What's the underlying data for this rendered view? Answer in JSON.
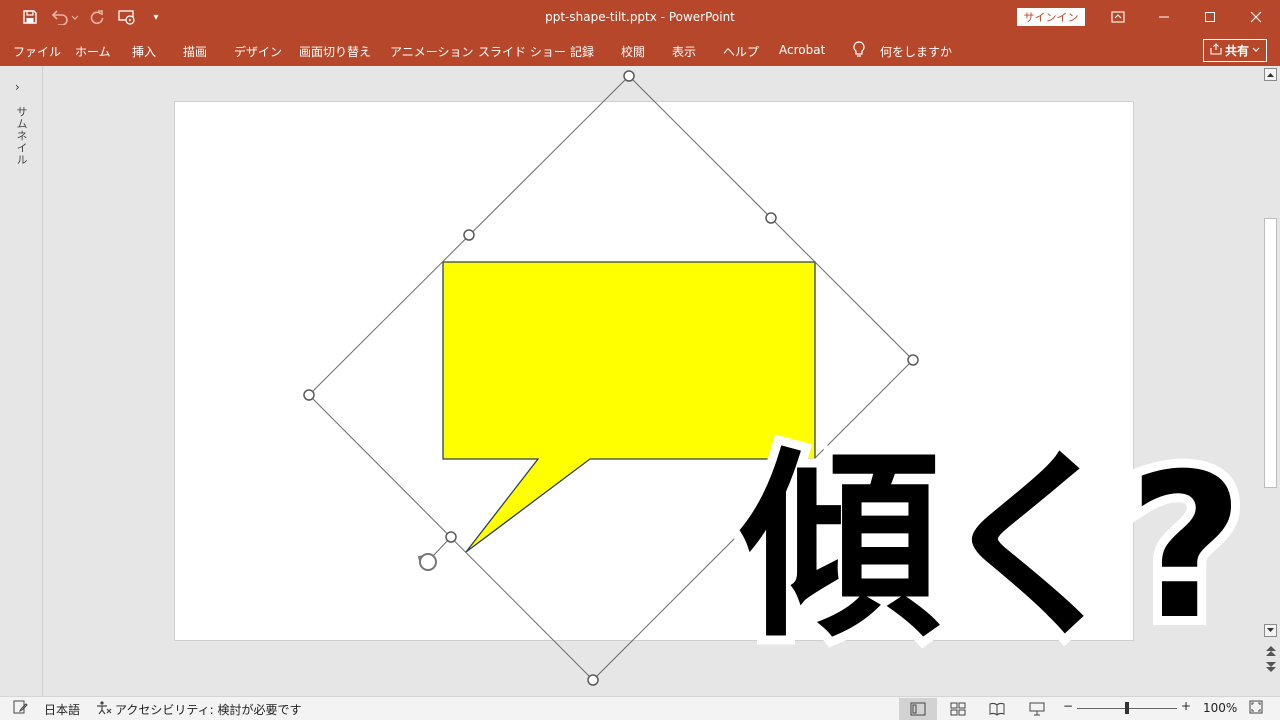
{
  "titlebar": {
    "doc_title": "ppt-shape-tilt.pptx  -  PowerPoint",
    "signin_label": "サインイン",
    "qat_more": "▾"
  },
  "tabs": [
    {
      "label": "ファイル"
    },
    {
      "label": "ホーム"
    },
    {
      "label": "挿入"
    },
    {
      "label": "描画"
    },
    {
      "label": "デザイン"
    },
    {
      "label": "画面切り替え"
    },
    {
      "label": "アニメーション"
    },
    {
      "label": "スライド ショー"
    },
    {
      "label": "記録"
    },
    {
      "label": "校閲"
    },
    {
      "label": "表示"
    },
    {
      "label": "ヘルプ"
    },
    {
      "label": "Acrobat"
    }
  ],
  "tellme": "何をしますか",
  "share_label": "共有",
  "thumbnail_pane": {
    "label": "サムネイル",
    "chevron": "›"
  },
  "slide": {
    "big_text": "傾く?"
  },
  "colors": {
    "accent": "#b7472a",
    "callout_fill": "#ffff00",
    "callout_stroke": "#2f3f55"
  },
  "statusbar": {
    "language": "日本語",
    "accessibility": "アクセシビリティ: 検討が必要です",
    "zoom": "100%",
    "zoom_minus": "−",
    "zoom_plus": "+"
  }
}
